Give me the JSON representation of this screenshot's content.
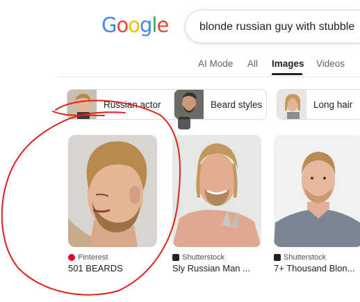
{
  "logo": {
    "letters": [
      "G",
      "o",
      "o",
      "g",
      "l",
      "e"
    ],
    "colors": [
      "#4285F4",
      "#EA4335",
      "#FBBC05",
      "#4285F4",
      "#34A853",
      "#EA4335"
    ]
  },
  "search": {
    "query": "blonde russian guy with stubble"
  },
  "tabs": [
    {
      "label": "AI Mode",
      "active": false
    },
    {
      "label": "All",
      "active": false
    },
    {
      "label": "Images",
      "active": true
    },
    {
      "label": "Videos",
      "active": false
    }
  ],
  "chips": [
    {
      "label": "Russian actor"
    },
    {
      "label": "Beard styles"
    },
    {
      "label": "Long hair"
    }
  ],
  "results": [
    {
      "source": "Pinterest",
      "title": "501 BEARDS",
      "source_color": "#E60023"
    },
    {
      "source": "Shutterstock",
      "title": "Sly Russian Man ...",
      "source_color": "#202124"
    },
    {
      "source": "Shutterstock",
      "title": "7+ Thousand Blon...",
      "source_color": "#202124"
    }
  ],
  "annotation_color": "#e0201a"
}
